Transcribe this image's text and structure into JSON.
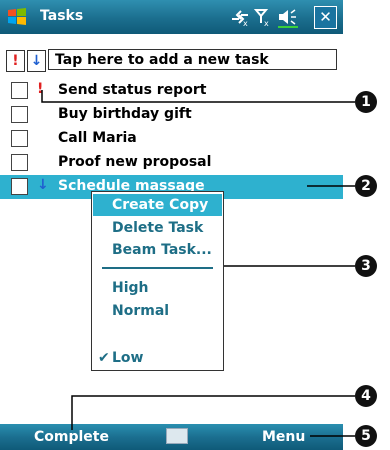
{
  "titlebar": {
    "title": "Tasks"
  },
  "entry": {
    "priority_high_glyph": "!",
    "priority_low_glyph": "↓",
    "placeholder": "Tap here to add a new task"
  },
  "tasks": [
    {
      "label": "Send status report",
      "priority_glyph": "!"
    },
    {
      "label": "Buy birthday gift",
      "priority_glyph": ""
    },
    {
      "label": "Call Maria",
      "priority_glyph": ""
    },
    {
      "label": "Proof new proposal",
      "priority_glyph": ""
    },
    {
      "label": "Schedule massage",
      "priority_glyph": "↓",
      "selected": true
    }
  ],
  "context_menu": {
    "items": [
      "Create Copy",
      "Delete Task",
      "Beam Task..."
    ],
    "priority_items": [
      "High",
      "Normal",
      "Low"
    ],
    "checked_glyph": "✔"
  },
  "bottombar": {
    "left": "Complete",
    "right": "Menu"
  },
  "callouts": [
    "1",
    "2",
    "3",
    "4",
    "5"
  ],
  "colors": {
    "accent": "#2eb1cf",
    "titlebar": "#1b6e8e",
    "menu_text": "#1e6e86",
    "high_priority": "#e02020",
    "low_priority": "#2060d0"
  }
}
